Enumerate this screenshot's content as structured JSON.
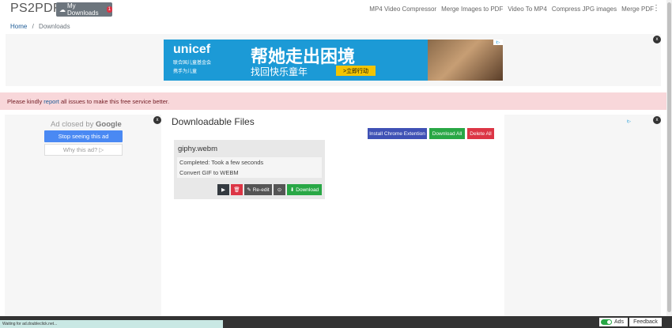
{
  "navbar": {
    "brand": "PS2PDF",
    "my_downloads": "My Downloads",
    "downloads_count": "1",
    "links": [
      "MP4 Video Compressor",
      "Merge Images to PDF",
      "Video To MP4",
      "Compress JPG images",
      "Merge PDF"
    ]
  },
  "breadcrumb": {
    "home": "Home",
    "current": "Downloads"
  },
  "top_ad": {
    "close": "x",
    "brand": "unicef",
    "brand_sub": "联合国儿童基金会",
    "brand_tag": "携手为儿童",
    "headline": "帮她走出困境",
    "subline": "找回快乐童年",
    "cta": ">立即行动",
    "adchoice": "i▷"
  },
  "alert": {
    "before": "Please kindly ",
    "link": "report",
    "after": " all issues to make this free service better."
  },
  "left_ad": {
    "close": "x",
    "closed_text": "Ad closed by",
    "google": "Google",
    "stop_label": "Stop seeing this ad",
    "why_label": "Why this ad? ▷"
  },
  "right_ad": {
    "close": "x",
    "adchoice": "i▷"
  },
  "main": {
    "title": "Downloadable Files",
    "install_chrome": "Install Chrome Extention",
    "download_all": "Download All",
    "delete_all": "Delete All"
  },
  "file_card": {
    "name": "giphy.webm",
    "status": "Completed: Took a few seconds",
    "operation": "Convert GIF to WEBM",
    "reedit": "Re-edit",
    "download": "Download"
  },
  "status_bar": {
    "loading_text": "Waiting for ad.doubleclick.net...",
    "ads_label": "Ads",
    "feedback_label": "Feedback"
  },
  "colors": {
    "install_chrome": "#3f51b5",
    "download_all": "#28a745",
    "delete_all": "#dc3545",
    "play": "#343a40",
    "delete": "#dc3545",
    "reedit": "#555555",
    "preview": "#555555",
    "download": "#28a745",
    "stop_ad": "#4a89f3"
  },
  "icons": [
    "cloud-download-icon",
    "kebab-menu-icon",
    "play-icon",
    "trash-icon",
    "pencil-icon",
    "eye-icon",
    "download-icon"
  ]
}
